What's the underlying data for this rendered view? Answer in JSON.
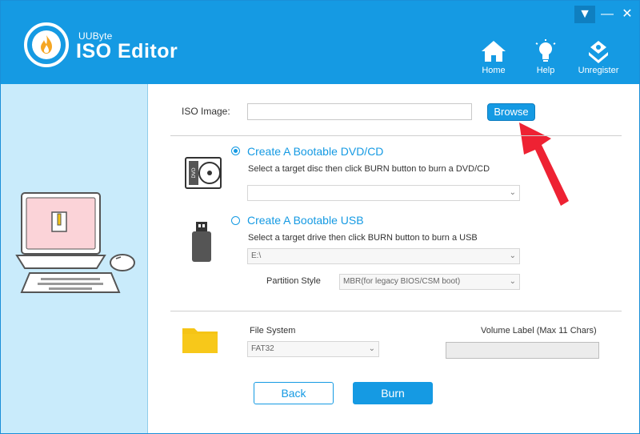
{
  "app": {
    "brand_small": "UUByte",
    "brand_big": "ISO Editor"
  },
  "header": {
    "buttons": [
      {
        "label": "Home",
        "icon": "home-icon"
      },
      {
        "label": "Help",
        "icon": "lightbulb-icon"
      },
      {
        "label": "Unregister",
        "icon": "unregister-icon"
      }
    ],
    "window_controls": {
      "dropdown": "▼",
      "minimize": "—",
      "close": "✕"
    }
  },
  "iso": {
    "label": "ISO Image:",
    "value": "",
    "browse_label": "Browse"
  },
  "dvd": {
    "title": "Create A Bootable DVD/CD",
    "description": "Select a target disc then click BURN button to burn a DVD/CD",
    "selected": true,
    "target_value": ""
  },
  "usb": {
    "title": "Create A Bootable USB",
    "description": "Select a target drive then click BURN button to burn a USB",
    "selected": false,
    "drive_value": "E:\\",
    "partition_label": "Partition Style",
    "partition_value": "MBR(for legacy BIOS/CSM boot)"
  },
  "filesystem": {
    "label": "File System",
    "value": "FAT32",
    "volume_label": "Volume Label (Max 11 Chars)",
    "volume_value": ""
  },
  "actions": {
    "back_label": "Back",
    "burn_label": "Burn"
  },
  "colors": {
    "accent": "#159ae3",
    "sidebar_bg": "#c9ebfb",
    "annotation_arrow": "#ee2233",
    "folder": "#f5c416"
  }
}
